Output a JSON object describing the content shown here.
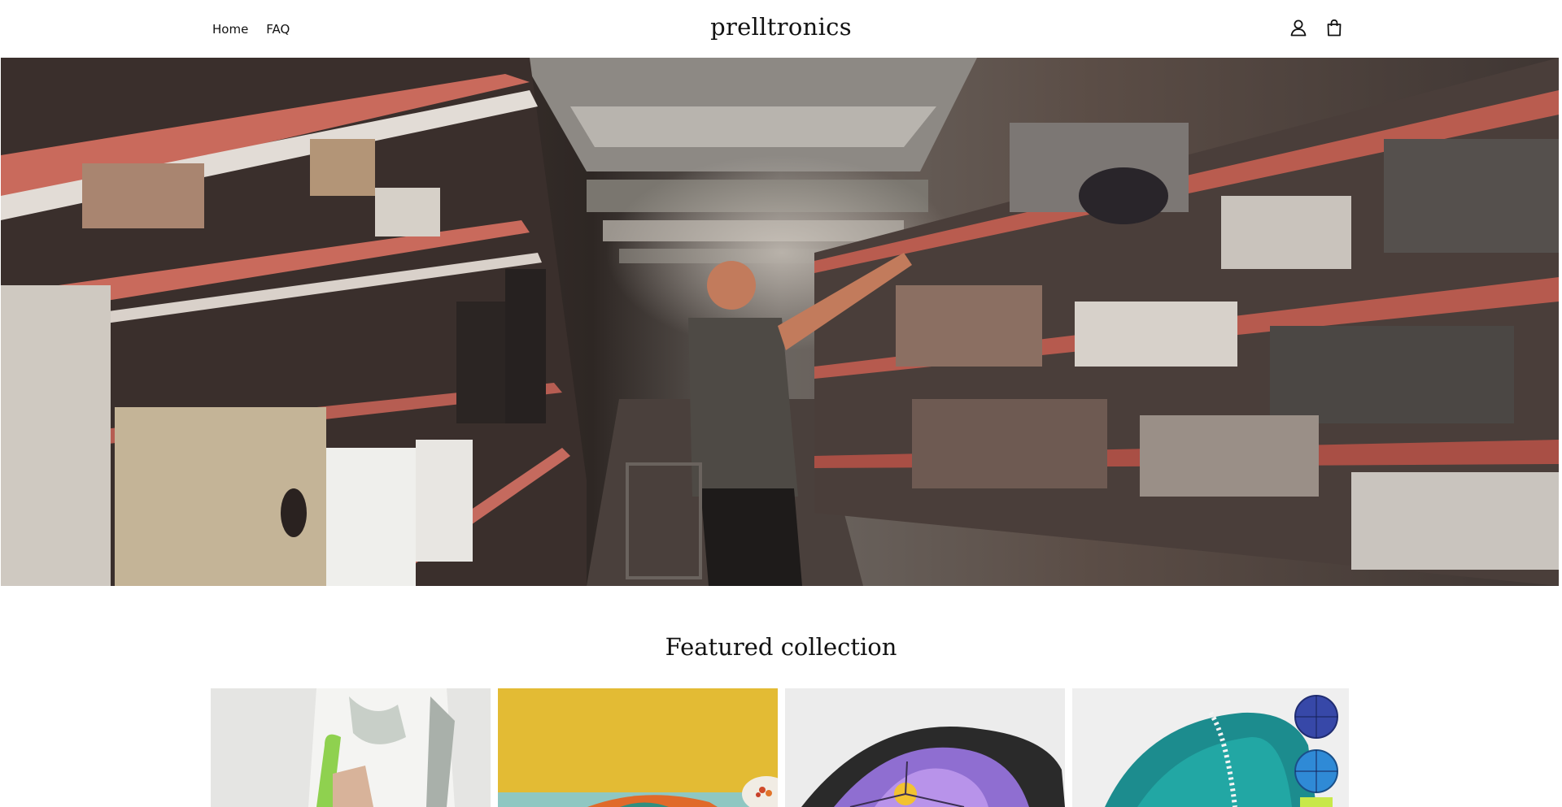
{
  "header": {
    "nav": [
      {
        "label": "Home"
      },
      {
        "label": "FAQ"
      }
    ],
    "brand": "prelltronics",
    "icons": [
      "account-icon",
      "cart-icon"
    ]
  },
  "hero": {
    "image": "warehouse-shelves-person-reaching-photo"
  },
  "featured": {
    "title": "Featured collection",
    "products": [
      {
        "image": "person-white-shirt-green-handle-photo"
      },
      {
        "image": "yellow-wall-umbrella-photo"
      },
      {
        "image": "purple-flower-umbrella-photo"
      },
      {
        "image": "teal-flower-umbrella-photo"
      }
    ]
  },
  "colors": {
    "text": "#121212",
    "background": "#ffffff"
  }
}
